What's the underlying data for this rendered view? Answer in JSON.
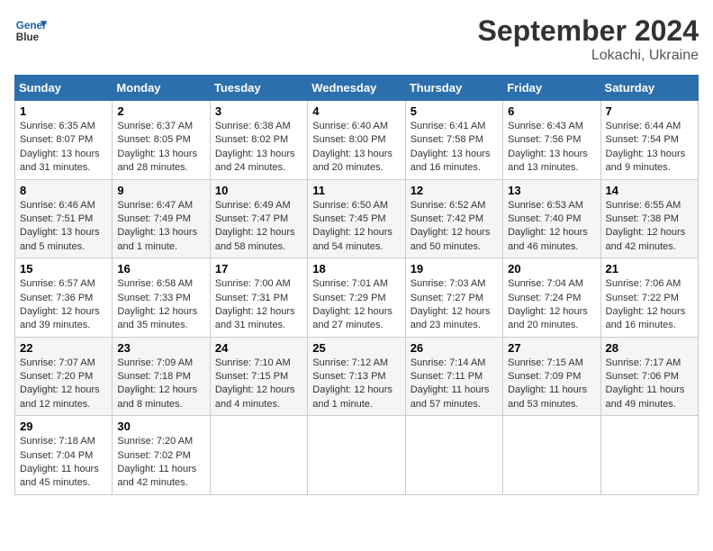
{
  "header": {
    "logo_line1": "General",
    "logo_line2": "Blue",
    "title": "September 2024",
    "subtitle": "Lokachi, Ukraine"
  },
  "weekdays": [
    "Sunday",
    "Monday",
    "Tuesday",
    "Wednesday",
    "Thursday",
    "Friday",
    "Saturday"
  ],
  "weeks": [
    [
      {
        "day": "1",
        "sunrise": "6:35 AM",
        "sunset": "8:07 PM",
        "daylight": "13 hours and 31 minutes."
      },
      {
        "day": "2",
        "sunrise": "6:37 AM",
        "sunset": "8:05 PM",
        "daylight": "13 hours and 28 minutes."
      },
      {
        "day": "3",
        "sunrise": "6:38 AM",
        "sunset": "8:02 PM",
        "daylight": "13 hours and 24 minutes."
      },
      {
        "day": "4",
        "sunrise": "6:40 AM",
        "sunset": "8:00 PM",
        "daylight": "13 hours and 20 minutes."
      },
      {
        "day": "5",
        "sunrise": "6:41 AM",
        "sunset": "7:58 PM",
        "daylight": "13 hours and 16 minutes."
      },
      {
        "day": "6",
        "sunrise": "6:43 AM",
        "sunset": "7:56 PM",
        "daylight": "13 hours and 13 minutes."
      },
      {
        "day": "7",
        "sunrise": "6:44 AM",
        "sunset": "7:54 PM",
        "daylight": "13 hours and 9 minutes."
      }
    ],
    [
      {
        "day": "8",
        "sunrise": "6:46 AM",
        "sunset": "7:51 PM",
        "daylight": "13 hours and 5 minutes."
      },
      {
        "day": "9",
        "sunrise": "6:47 AM",
        "sunset": "7:49 PM",
        "daylight": "13 hours and 1 minute."
      },
      {
        "day": "10",
        "sunrise": "6:49 AM",
        "sunset": "7:47 PM",
        "daylight": "12 hours and 58 minutes."
      },
      {
        "day": "11",
        "sunrise": "6:50 AM",
        "sunset": "7:45 PM",
        "daylight": "12 hours and 54 minutes."
      },
      {
        "day": "12",
        "sunrise": "6:52 AM",
        "sunset": "7:42 PM",
        "daylight": "12 hours and 50 minutes."
      },
      {
        "day": "13",
        "sunrise": "6:53 AM",
        "sunset": "7:40 PM",
        "daylight": "12 hours and 46 minutes."
      },
      {
        "day": "14",
        "sunrise": "6:55 AM",
        "sunset": "7:38 PM",
        "daylight": "12 hours and 42 minutes."
      }
    ],
    [
      {
        "day": "15",
        "sunrise": "6:57 AM",
        "sunset": "7:36 PM",
        "daylight": "12 hours and 39 minutes."
      },
      {
        "day": "16",
        "sunrise": "6:58 AM",
        "sunset": "7:33 PM",
        "daylight": "12 hours and 35 minutes."
      },
      {
        "day": "17",
        "sunrise": "7:00 AM",
        "sunset": "7:31 PM",
        "daylight": "12 hours and 31 minutes."
      },
      {
        "day": "18",
        "sunrise": "7:01 AM",
        "sunset": "7:29 PM",
        "daylight": "12 hours and 27 minutes."
      },
      {
        "day": "19",
        "sunrise": "7:03 AM",
        "sunset": "7:27 PM",
        "daylight": "12 hours and 23 minutes."
      },
      {
        "day": "20",
        "sunrise": "7:04 AM",
        "sunset": "7:24 PM",
        "daylight": "12 hours and 20 minutes."
      },
      {
        "day": "21",
        "sunrise": "7:06 AM",
        "sunset": "7:22 PM",
        "daylight": "12 hours and 16 minutes."
      }
    ],
    [
      {
        "day": "22",
        "sunrise": "7:07 AM",
        "sunset": "7:20 PM",
        "daylight": "12 hours and 12 minutes."
      },
      {
        "day": "23",
        "sunrise": "7:09 AM",
        "sunset": "7:18 PM",
        "daylight": "12 hours and 8 minutes."
      },
      {
        "day": "24",
        "sunrise": "7:10 AM",
        "sunset": "7:15 PM",
        "daylight": "12 hours and 4 minutes."
      },
      {
        "day": "25",
        "sunrise": "7:12 AM",
        "sunset": "7:13 PM",
        "daylight": "12 hours and 1 minute."
      },
      {
        "day": "26",
        "sunrise": "7:14 AM",
        "sunset": "7:11 PM",
        "daylight": "11 hours and 57 minutes."
      },
      {
        "day": "27",
        "sunrise": "7:15 AM",
        "sunset": "7:09 PM",
        "daylight": "11 hours and 53 minutes."
      },
      {
        "day": "28",
        "sunrise": "7:17 AM",
        "sunset": "7:06 PM",
        "daylight": "11 hours and 49 minutes."
      }
    ],
    [
      {
        "day": "29",
        "sunrise": "7:18 AM",
        "sunset": "7:04 PM",
        "daylight": "11 hours and 45 minutes."
      },
      {
        "day": "30",
        "sunrise": "7:20 AM",
        "sunset": "7:02 PM",
        "daylight": "11 hours and 42 minutes."
      },
      null,
      null,
      null,
      null,
      null
    ]
  ]
}
